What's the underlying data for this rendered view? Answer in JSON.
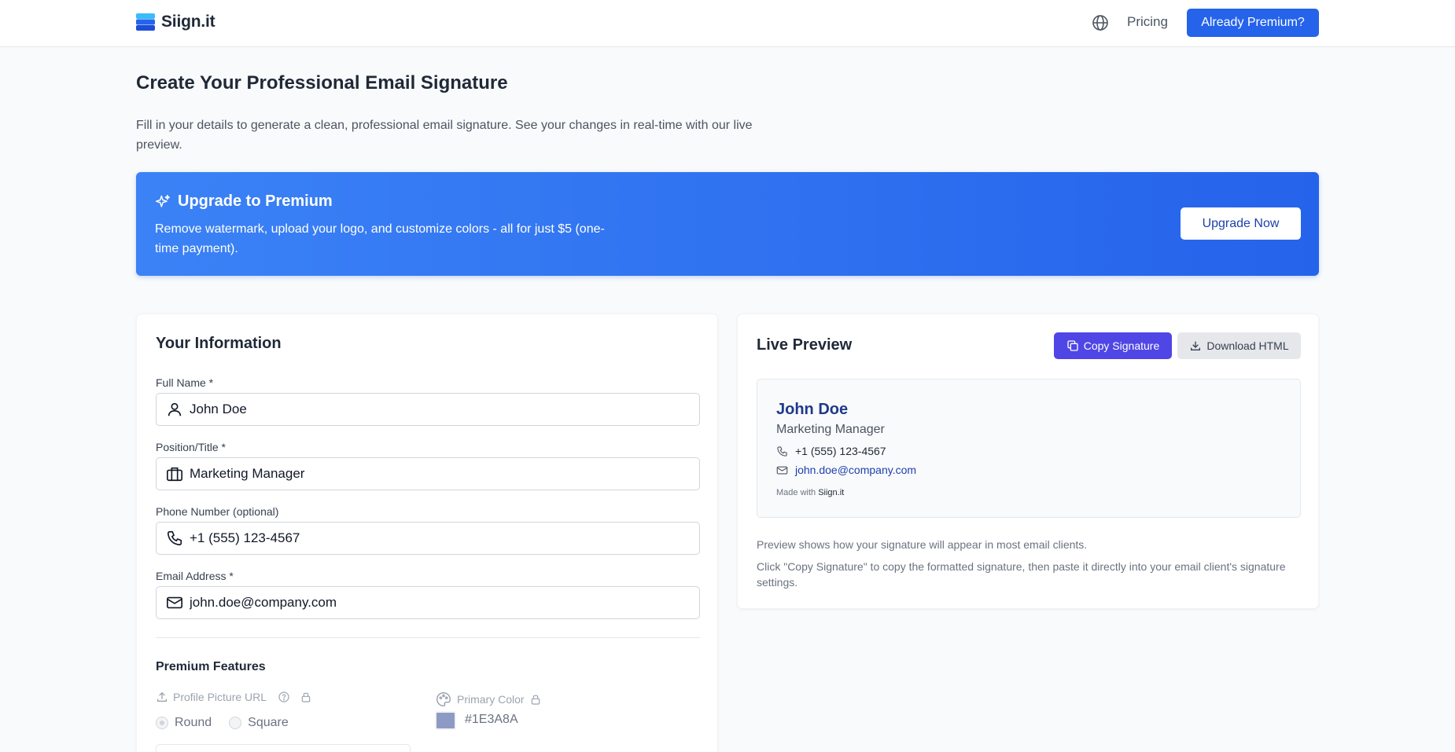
{
  "header": {
    "brand": "Siign.it",
    "pricing_label": "Pricing",
    "premium_button": "Already Premium?"
  },
  "intro": {
    "title": "Create Your Professional Email Signature",
    "description": "Fill in your details to generate a clean, professional email signature. See your changes in real-time with our live preview."
  },
  "banner": {
    "title": "Upgrade to Premium",
    "text": "Remove watermark, upload your logo, and customize colors - all for just $5 (one-time payment).",
    "button": "Upgrade Now"
  },
  "form": {
    "title": "Your Information",
    "fields": [
      {
        "label": "Full Name *",
        "value": "John Doe",
        "icon": "user-icon"
      },
      {
        "label": "Position/Title *",
        "value": "Marketing Manager",
        "icon": "briefcase-icon"
      },
      {
        "label": "Phone Number (optional)",
        "value": "+1 (555) 123-4567",
        "icon": "phone-icon"
      },
      {
        "label": "Email Address *",
        "value": "john.doe@company.com",
        "icon": "mail-icon"
      }
    ],
    "premium": {
      "title": "Premium Features",
      "profile_picture_label": "Profile Picture URL",
      "shape_options": [
        "Round",
        "Square"
      ],
      "selected_shape": "Round",
      "primary_color_label": "Primary Color",
      "primary_color_value": "#1E3A8A",
      "primary_color": "#1E3A8A"
    }
  },
  "preview": {
    "title": "Live Preview",
    "copy_button": "Copy Signature",
    "download_button": "Download HTML",
    "signature": {
      "name": "John Doe",
      "title": "Marketing Manager",
      "phone": "+1 (555) 123-4567",
      "email": "john.doe@company.com",
      "made_with_prefix": "Made with",
      "made_with_brand": "Siign.it"
    },
    "hints": [
      "Preview shows how your signature will appear in most email clients.",
      "Click \"Copy Signature\" to copy the formatted signature, then paste it directly into your email client's signature settings."
    ]
  },
  "colors": {
    "accent": "#2563eb",
    "copy_button": "#4f46e5",
    "signature_name": "#1e3a8a"
  }
}
